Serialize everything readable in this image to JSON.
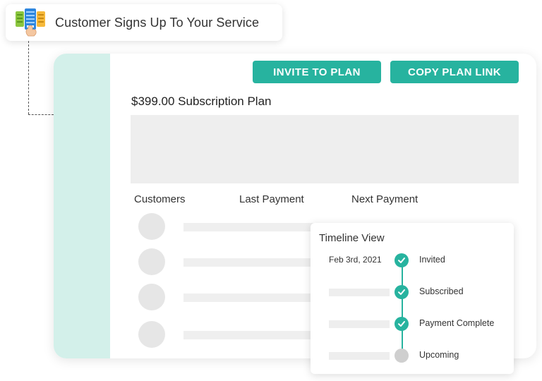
{
  "step": {
    "title": "Customer Signs Up To Your Service",
    "icon": "signup-cards-icon"
  },
  "plan": {
    "invite_label": "INVITE TO PLAN",
    "copy_link_label": "COPY PLAN LINK",
    "title": "$399.00 Subscription Plan"
  },
  "customers_table": {
    "columns": [
      "Customers",
      "Last Payment",
      "Next Payment"
    ],
    "rows": 4
  },
  "timeline": {
    "title": "Timeline View",
    "events": [
      {
        "date": "Feb 3rd, 2021",
        "label": "Invited",
        "status": "complete"
      },
      {
        "date": "",
        "label": "Subscribed",
        "status": "complete"
      },
      {
        "date": "",
        "label": "Payment Complete",
        "status": "complete"
      },
      {
        "date": "",
        "label": "Upcoming",
        "status": "pending"
      }
    ]
  },
  "colors": {
    "accent": "#27b39f",
    "sidebar": "#d3f0ea",
    "placeholder": "#eeeeee",
    "pending": "#cfcfcf"
  }
}
